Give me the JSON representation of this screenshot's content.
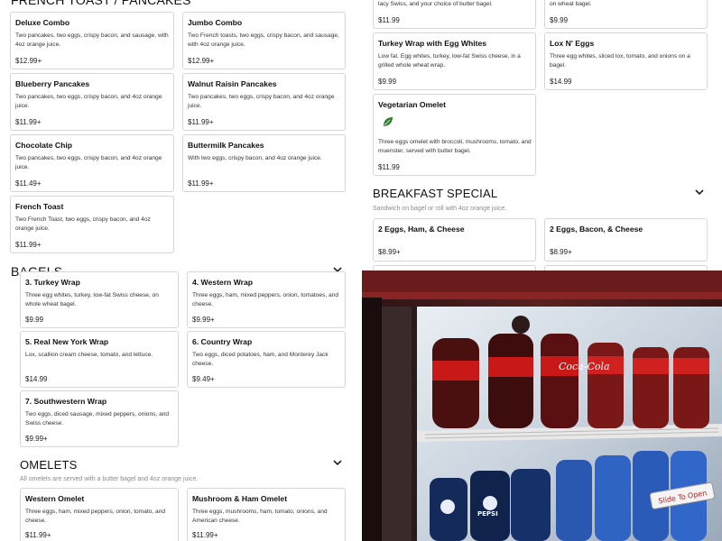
{
  "pancakes": {
    "heading": "FRENCH TOAST / PANCAKES",
    "items": [
      {
        "name": "Deluxe Combo",
        "desc": "Two pancakes, two eggs, crispy bacon, and sausage, with 4oz orange juice.",
        "price": "$12.99+"
      },
      {
        "name": "Jumbo Combo",
        "desc": "Two French toasts, two eggs, crispy bacon, and sausage, with 4oz orange juice.",
        "price": "$12.99+"
      },
      {
        "name": "Blueberry Pancakes",
        "desc": "Two pancakes, two eggs, crispy bacon, and 4oz orange juice.",
        "price": "$11.99+"
      },
      {
        "name": "Walnut Raisin Pancakes",
        "desc": "Two pancakes, two eggs, crispy bacon, and 4oz orange juice.",
        "price": "$11.99+"
      },
      {
        "name": "Chocolate Chip",
        "desc": "Two pancakes, two eggs, crispy bacon, and 4oz orange juice.",
        "price": "$11.49+"
      },
      {
        "name": "Buttermilk Pancakes",
        "desc": "With two eggs, crispy bacon, and 4oz orange juice.",
        "price": "$11.99+"
      },
      {
        "name": "French Toast",
        "desc": "Two French Toast, two eggs, crispy bacon, and 4oz orange juice.",
        "price": "$11.99+"
      }
    ]
  },
  "bagels": {
    "heading": "BAGELS",
    "items": [
      {
        "name": "3. Turkey Wrap",
        "desc": "Three egg whites, turkey, low-fat Swiss cheese, on whole wheat bagel.",
        "price": "$9.99"
      },
      {
        "name": "4. Western Wrap",
        "desc": "Three eggs, ham, mixed peppers, onion, tomatoes, and cheese.",
        "price": "$9.99+"
      },
      {
        "name": "5. Real New York Wrap",
        "desc": "Lox, scallion cream cheese, tomato, and lettuce.",
        "price": "$14.99"
      },
      {
        "name": "6. Country Wrap",
        "desc": "Two eggs, diced potatoes, ham, and Monterey Jack cheese.",
        "price": "$9.49+"
      },
      {
        "name": "7. Southwestern Wrap",
        "desc": "Two eggs, diced sausage, mixed peppers, onions, and Swiss cheese.",
        "price": "$9.99+"
      }
    ]
  },
  "omelets": {
    "heading": "OMELETS",
    "subtitle": "All omelets are served with a butter bagel and 4oz orange juice.",
    "items": [
      {
        "name": "Western Omelet",
        "desc": "Three eggs, ham, mixed peppers, onion, tomato, and cheese.",
        "price": "$11.99+"
      },
      {
        "name": "Mushroom & Ham Omelet",
        "desc": "Three eggs, mushrooms, ham, tomato, onions, and American cheese.",
        "price": "$11.99+"
      }
    ]
  },
  "right_top": {
    "items": [
      {
        "name": "",
        "desc": "lacy Swiss, and your choice of butter bagel.",
        "price": "$11.99"
      },
      {
        "name": "",
        "desc": "on wheat bagel.",
        "price": "$9.99"
      },
      {
        "name": "Turkey Wrap with Egg Whites",
        "desc": "Low fat. Egg whites, turkey, low-fat Swiss cheese, in a grilled whole wheat wrap.",
        "price": "$9.99"
      },
      {
        "name": "Lox N' Eggs",
        "desc": "Three egg whites, sliced lox, tomato, and onions on a bagel.",
        "price": "$14.99"
      },
      {
        "name": "Vegetarian Omelet",
        "desc": "Three eggs omelet with broccoli, mushrooms, tomato, and muenster, served with butter bagel.",
        "price": "$11.99"
      }
    ]
  },
  "breakfast_special": {
    "heading": "BREAKFAST SPECIAL",
    "subtitle": "Sandwich on bagel or roll with 4oz orange juice.",
    "items": [
      {
        "name": "2 Eggs, Ham, & Cheese",
        "price": "$8.99+"
      },
      {
        "name": "2 Eggs, Bacon, & Cheese",
        "price": "$8.99+"
      }
    ]
  },
  "photo": {
    "brand_text": "Coca-Cola",
    "door_sign": "Slide To Open",
    "bottle_label": "PEPSI"
  },
  "icons": {
    "chevron": "chevron-down-icon",
    "veg": "leaf-icon"
  },
  "colors": {
    "card_border": "#d6d6d6",
    "leaf": "#2e7d32",
    "fridge_red": "#b01818"
  }
}
